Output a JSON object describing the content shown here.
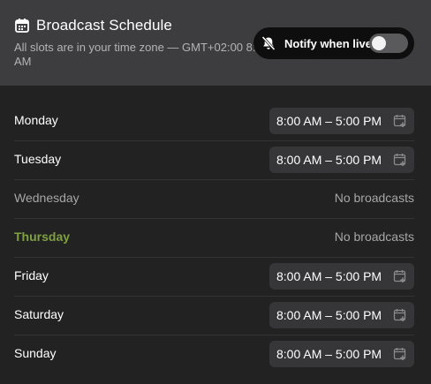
{
  "header": {
    "icon": "calendar-icon",
    "title": "Broadcast Schedule",
    "subtitle": "All slots are in your time zone — GMT+02:00 8:58 AM",
    "notify": {
      "icon": "bell-off-icon",
      "label": "Notify when live:",
      "enabled": false
    }
  },
  "schedule": [
    {
      "day": "Monday",
      "slot": "8:00 AM – 5:00 PM",
      "state": "slot"
    },
    {
      "day": "Tuesday",
      "slot": "8:00 AM – 5:00 PM",
      "state": "slot"
    },
    {
      "day": "Wednesday",
      "slot": "No broadcasts",
      "state": "none"
    },
    {
      "day": "Thursday",
      "slot": "No broadcasts",
      "state": "today-none"
    },
    {
      "day": "Friday",
      "slot": "8:00 AM – 5:00 PM",
      "state": "slot"
    },
    {
      "day": "Saturday",
      "slot": "8:00 AM – 5:00 PM",
      "state": "slot"
    },
    {
      "day": "Sunday",
      "slot": "8:00 AM – 5:00 PM",
      "state": "slot"
    }
  ],
  "slot_action_icon": "calendar-add-icon",
  "colors": {
    "header_bg": "#3d3d3f",
    "panel_bg": "#222222",
    "today_accent": "#7fa043",
    "muted_text": "#a6a6a6"
  }
}
